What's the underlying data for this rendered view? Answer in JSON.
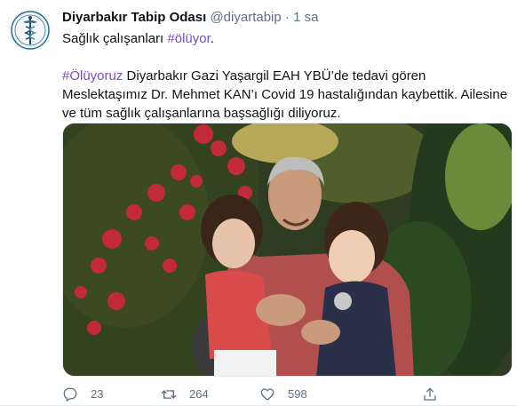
{
  "tweet": {
    "author_name": "Diyarbakır Tabip Odası",
    "handle": "@diyartabip",
    "separator": "·",
    "time": "1 sa",
    "line1_text": "Sağlık çalışanları ",
    "line1_hashtag": "#ölüyor",
    "line1_end": ".",
    "body_hashtag": "#Ölüyoruz",
    "body_text": " Diyarbakır Gazi Yaşargil EAH YBÜ’de tedavi gören Meslektaşımız Dr. Mehmet KAN’ı Covid 19 hastalığından kaybettik. Ailesine ve tüm sağlık çalışanlarına başsağlığı diliyoruz."
  },
  "actions": {
    "replies": "23",
    "retweets": "264",
    "likes": "598"
  },
  "icons": {
    "reply": "reply-icon",
    "retweet": "retweet-icon",
    "like": "heart-icon",
    "share": "share-icon"
  },
  "colors": {
    "hashtag": "#794bc4",
    "meta": "#5b7083"
  }
}
